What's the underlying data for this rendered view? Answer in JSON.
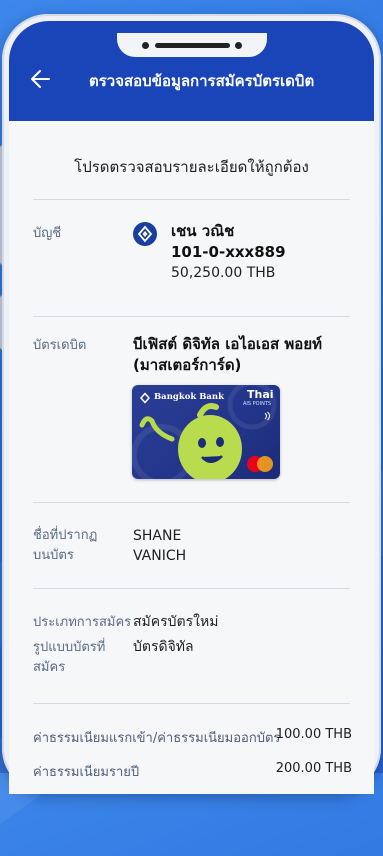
{
  "header": {
    "title": "ตรวจสอบข้อมูลการสมัครบัตรเดบิต"
  },
  "subtitle": "โปรดตรวจสอบรายละเอียดให้ถูกต้อง",
  "account": {
    "label": "บัญชี",
    "name": "เชน วณิช",
    "number": "101-0-xxx889",
    "balance": "50,250.00 THB"
  },
  "debit_card": {
    "label": "บัตรเดบิต",
    "name_line1": "บีเฟิสต์ ดิจิทัล เอไอเอส พอยท์",
    "name_line2": "(มาสเตอร์การ์ด)",
    "card_brand": "Bangkok Bank",
    "partner": "Thai",
    "partner_sub": "AIS POINTS"
  },
  "card_name": {
    "label_line1": "ชื่อที่ปรากฏ",
    "label_line2": "บนบัตร",
    "line1": "SHANE",
    "line2": "VANICH"
  },
  "application_type": {
    "label": "ประเภทการสมัคร",
    "value": "สมัครบัตรใหม่"
  },
  "card_format": {
    "label_line1": "รูปแบบบัตรที่",
    "label_line2": "สมัคร",
    "value": "บัตรดิจิทัล"
  },
  "fees": [
    {
      "label": "ค่าธรรมเนียมแรกเข้า/ค่าธรรมเนียมออกบัตร",
      "amount": "100.00 THB"
    },
    {
      "label": "ค่าธรรมเนียมรายปี",
      "amount": "200.00 THB"
    }
  ]
}
